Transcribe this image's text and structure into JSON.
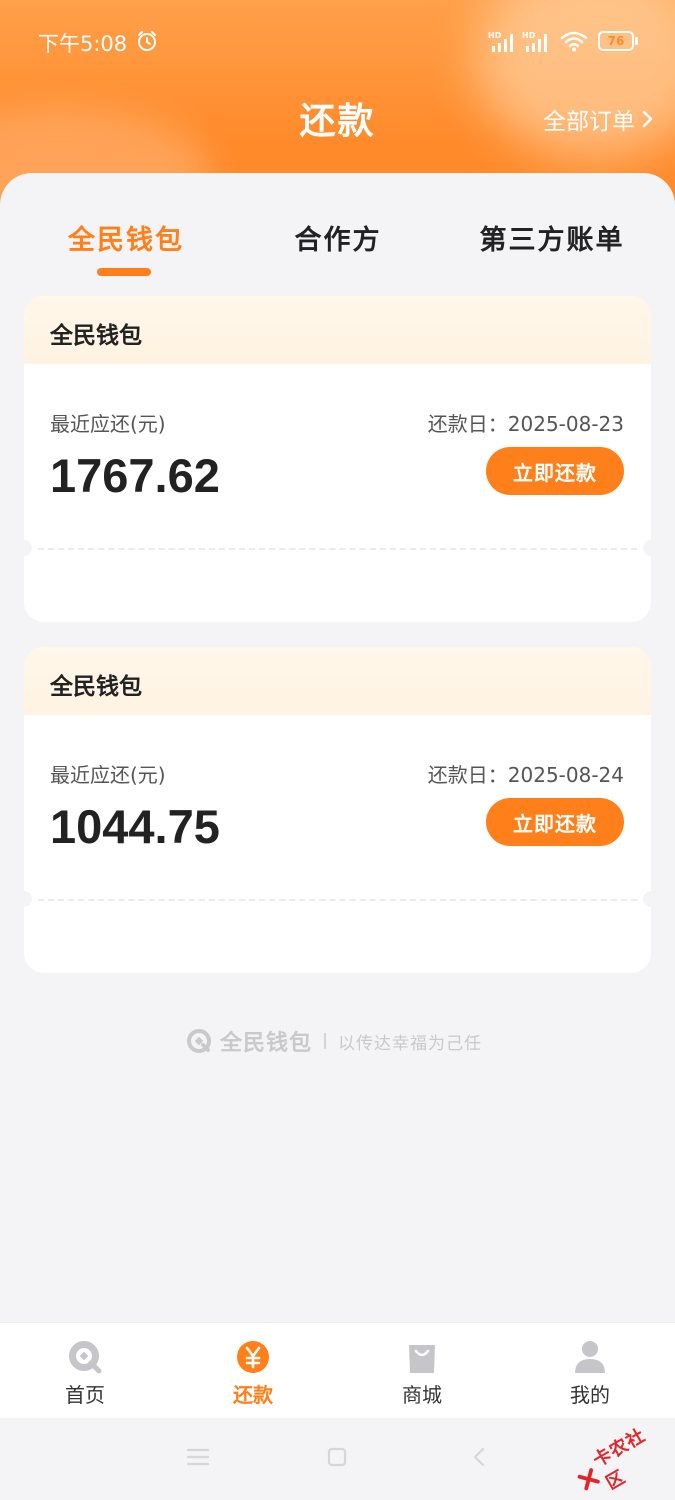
{
  "status_bar": {
    "time": "下午5:08",
    "battery": "76"
  },
  "header": {
    "title": "还款",
    "all_orders": "全部订单"
  },
  "tabs": [
    {
      "label": "全民钱包",
      "active": true
    },
    {
      "label": "合作方",
      "active": false
    },
    {
      "label": "第三方账单",
      "active": false
    }
  ],
  "bills": [
    {
      "title": "全民钱包",
      "due_label": "最近应还(元)",
      "due_date": "还款日：2025-08-23",
      "amount": "1767.62",
      "pay_label": "立即还款"
    },
    {
      "title": "全民钱包",
      "due_label": "最近应还(元)",
      "due_date": "还款日：2025-08-24",
      "amount": "1044.75",
      "pay_label": "立即还款"
    }
  ],
  "brand": {
    "name": "全民钱包",
    "slogan": "以传达幸福为己任"
  },
  "bottom_nav": [
    {
      "label": "首页",
      "icon": "home-icon",
      "active": false
    },
    {
      "label": "还款",
      "icon": "repay-icon",
      "active": true
    },
    {
      "label": "商城",
      "icon": "shop-bag-icon",
      "active": false
    },
    {
      "label": "我的",
      "icon": "profile-icon",
      "active": false
    }
  ],
  "watermark": {
    "text": "卡农社区"
  },
  "colors": {
    "accent": "#ff7f1a",
    "header_orange": "#ff8a2a",
    "background": "#f4f4f6"
  }
}
